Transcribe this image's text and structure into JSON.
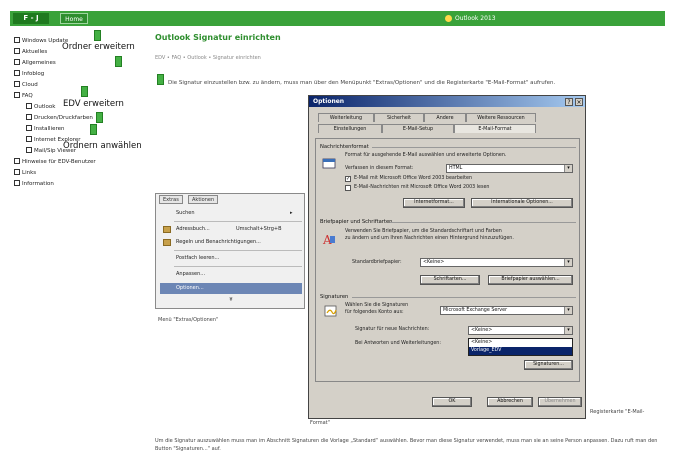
{
  "topbar": {
    "logo_label": "F - J",
    "home_label": "Home",
    "right_label": "Outlook 2013"
  },
  "sidebar": {
    "items": [
      {
        "label": "Windows Update"
      },
      {
        "label": "Aktuelles"
      },
      {
        "label": "Allgemeines"
      },
      {
        "label": "Infoblog"
      },
      {
        "label": "Cloud"
      },
      {
        "label": "FAQ"
      },
      {
        "label": "Outlook"
      },
      {
        "label": "Drucken/Druckfarben"
      },
      {
        "label": "Installieren"
      },
      {
        "label": "Internet Explorer"
      },
      {
        "label": "Mail/Sip Viewer"
      },
      {
        "label": "Hinweise für EDV-Benutzer"
      },
      {
        "label": "Links"
      },
      {
        "label": "Information"
      }
    ]
  },
  "annotations": {
    "a1": "Ordner erweitern",
    "a2": "EDV erweitern",
    "a3": "Ordnern anwählen"
  },
  "content": {
    "title": "Outlook Signatur einrichten",
    "breadcrumb": "EDV • FAQ • Outlook • Signatur einrichten",
    "intro": "Die Signatur einzustellen bzw. zu ändern, muss man über den Menüpunkt \"Extras/Optionen\" und die Registerkarte \"E-Mail-Format\" aufrufen.",
    "menu_caption": "Menü \"Extras/Optionen\"",
    "caption_right": "Registerkarte \"E-Mail-",
    "caption_right2": "Format\"",
    "bottom_text": "Um die Signatur auszuwählen muss man im Abschnitt Signaturen die Vorlage „Standard“ auswählen. Bevor man diese Signatur verwendet, muss man sie an seine Person anpassen. Dazu ruft man den Button \"Signaturen...\" auf."
  },
  "menu": {
    "tabs": [
      "Extras",
      "Aktionen"
    ],
    "items": [
      {
        "label": "Suchen",
        "shortcut": "▸",
        "selected": false
      },
      {
        "label": "Adressbuch...",
        "shortcut": "Umschalt+Strg+B",
        "selected": false
      },
      {
        "label": "Regeln und Benachrichtigungen...",
        "shortcut": "",
        "selected": false
      },
      {
        "label": "Postfach leeren...",
        "shortcut": "",
        "selected": false
      },
      {
        "label": "Anpassen...",
        "shortcut": "",
        "selected": false
      },
      {
        "label": "Optionen...",
        "shortcut": "",
        "selected": true
      }
    ],
    "more": "¥"
  },
  "dialog": {
    "title": "Optionen",
    "tabs_row1": [
      "Weiterleitung",
      "Sicherheit",
      "Andere",
      "Weitere Ressourcen"
    ],
    "tabs_row2": [
      "Einstellungen",
      "E-Mail-Setup",
      "E-Mail-Format"
    ],
    "group1": {
      "title": "Nachrichtenformat",
      "desc": "Format für ausgehende E-Mail auswählen und erweiterte Optionen.",
      "field_label": "Verfassen in diesem Format:",
      "field_value": "HTML",
      "cb1": "E-Mail mit Microsoft Office Word 2003 bearbeiten",
      "cb2": "E-Mail-Nachrichten mit Microsoft Office Word 2003 lesen",
      "btn1": "Internetformat...",
      "btn2": "Internationale Optionen..."
    },
    "group2": {
      "title": "Briefpapier und Schriftarten",
      "desc1": "Verwenden Sie Briefpapier, um die Standardschriftart und Farben",
      "desc2": "zu ändern und um Ihren Nachrichten einen Hintergrund hinzuzufügen.",
      "field_label": "Standardbriefpapier:",
      "field_value": "<Keine>",
      "btn1": "Schriftarten...",
      "btn2": "Briefpapier auswählen..."
    },
    "group3": {
      "title": "Signaturen",
      "desc1": "Wählen Sie die Signaturen",
      "desc2": "für folgendes Konto aus:",
      "account_value": "Microsoft Exchange Server",
      "field1_label": "Signatur für neue Nachrichten:",
      "field1_value": "<Keine>",
      "field2_label": "Bei Antworten und Weiterleitungen:",
      "dd_options": [
        "<Keine>",
        "Vorlage_EDV"
      ],
      "btn": "Signaturen..."
    },
    "ok": "OK",
    "cancel": "Abbrechen",
    "apply": "Übernehmen"
  }
}
